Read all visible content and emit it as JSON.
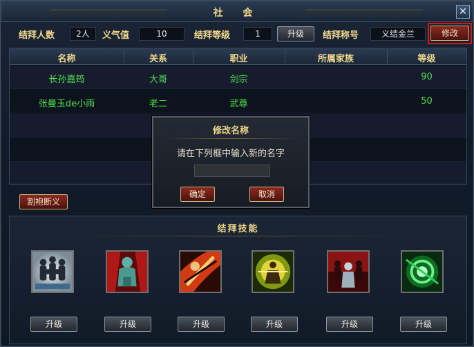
{
  "window": {
    "title": "社 会",
    "close_glyph": "✕"
  },
  "stats": {
    "members_label": "结拜人数",
    "members_value": "2人",
    "loyalty_label": "义气值",
    "loyalty_value": "10",
    "level_label": "结拜等级",
    "level_value": "1",
    "upgrade_label": "升级",
    "name_label": "结拜称号",
    "name_value": "义结金兰",
    "edit_label": "修改"
  },
  "table": {
    "headers": [
      "名称",
      "关系",
      "职业",
      "所属家族",
      "等级"
    ],
    "rows": [
      {
        "name": "长孙嘉筠",
        "relation": "大哥",
        "class": "剑宗",
        "family": "",
        "level": "90"
      },
      {
        "name": "张曼玉de小雨",
        "relation": "老二",
        "class": "武尊",
        "family": "",
        "level": "50"
      }
    ]
  },
  "disband_label": "割袍断义",
  "skills": {
    "title": "结拜技能",
    "upgrade_label": "升级",
    "icons": [
      "group-figures-icon",
      "red-warrior-icon",
      "fire-slash-icon",
      "golden-aura-icon",
      "red-crowd-icon",
      "green-vortex-icon"
    ]
  },
  "dialog": {
    "title": "修改名称",
    "message": "请在下列框中输入新的名字",
    "input_value": "",
    "confirm_label": "确定",
    "cancel_label": "取消"
  },
  "colors": {
    "gold": "#f2d98a",
    "green_text": "#4ee04e",
    "highlight": "#e01414"
  }
}
